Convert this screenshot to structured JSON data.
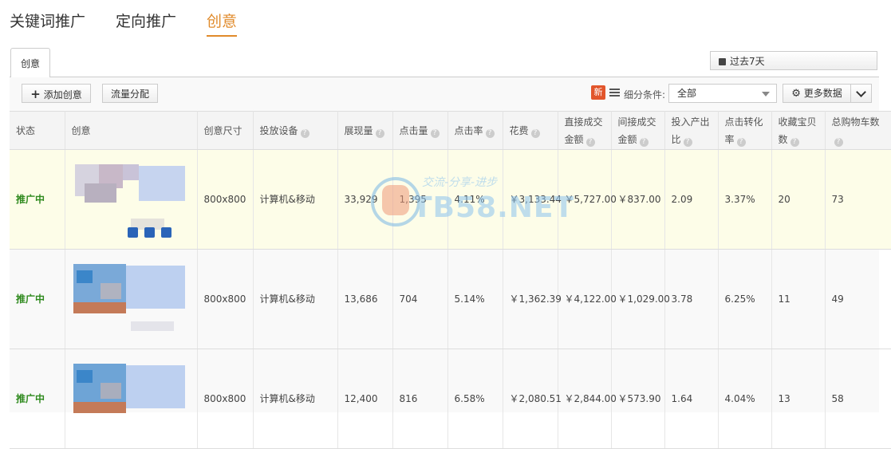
{
  "top_tabs": [
    "关键词推广",
    "定向推广",
    "创意"
  ],
  "panel_tab": "创意",
  "date_range": "过去7天",
  "toolbar": {
    "add_creative": "添加创意",
    "traffic_split": "流量分配",
    "new_badge": "新",
    "filter_label": "细分条件:",
    "filter_value": "全部",
    "more_data": "更多数据"
  },
  "columns": [
    "状态",
    "创意",
    "创意尺寸",
    "投放设备",
    "展现量",
    "点击量",
    "点击率",
    "花费",
    "直接成交金额",
    "间接成交金额",
    "投入产出比",
    "点击转化率",
    "收藏宝贝数",
    "总购物车数"
  ],
  "rows": [
    {
      "status": "推广中",
      "size": "800x800",
      "device": "计算机&移动",
      "impressions": "33,929",
      "clicks": "1,395",
      "ctr": "4.11%",
      "cost": "￥3,133.44",
      "direct": "￥5,727.00",
      "indirect": "￥837.00",
      "roi": "2.09",
      "cvr": "3.37%",
      "fav": "20",
      "cart": "73"
    },
    {
      "status": "推广中",
      "size": "800x800",
      "device": "计算机&移动",
      "impressions": "13,686",
      "clicks": "704",
      "ctr": "5.14%",
      "cost": "￥1,362.39",
      "direct": "￥4,122.00",
      "indirect": "￥1,029.00",
      "roi": "3.78",
      "cvr": "6.25%",
      "fav": "11",
      "cart": "49"
    },
    {
      "status": "推广中",
      "size": "800x800",
      "device": "计算机&移动",
      "impressions": "12,400",
      "clicks": "816",
      "ctr": "6.58%",
      "cost": "￥2,080.51",
      "direct": "￥2,844.00",
      "indirect": "￥573.90",
      "roi": "1.64",
      "cvr": "4.04%",
      "fav": "13",
      "cart": "58"
    }
  ],
  "watermark": {
    "tag": "交流-分享-进步",
    "text": "TB58.NET"
  },
  "colors": {
    "accent": "#e08a2a",
    "status": "#2f8a1e",
    "highlight_row": "#fdfde8"
  }
}
